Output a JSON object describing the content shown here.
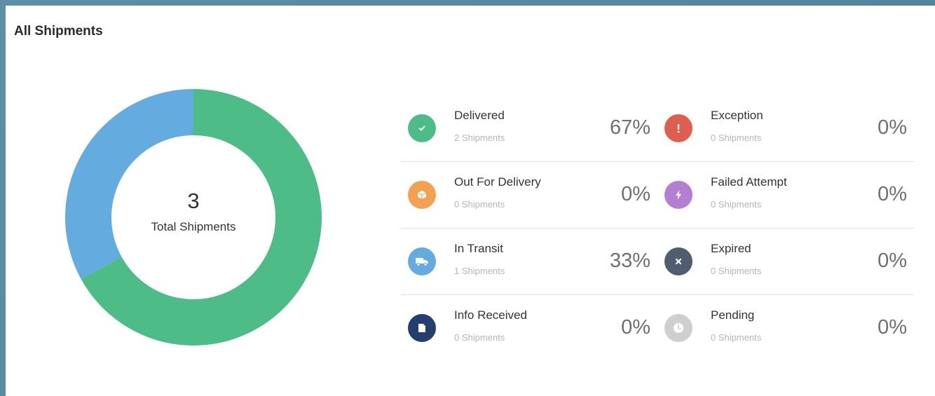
{
  "card": {
    "title": "All Shipments"
  },
  "chart_data": {
    "type": "pie",
    "total": {
      "value": "3",
      "label": "Total Shipments"
    },
    "slices": [
      {
        "label": "Delivered",
        "value": 67,
        "color": "#4dbc86"
      },
      {
        "label": "In Transit",
        "value": 33,
        "color": "#64abe0"
      }
    ]
  },
  "statuses": [
    {
      "name": "Delivered",
      "count": "2 Shipments",
      "pct": "67%",
      "color": "#4dbc86",
      "icon": "check-icon"
    },
    {
      "name": "Exception",
      "count": "0 Shipments",
      "pct": "0%",
      "color": "#de5f4f",
      "icon": "exclamation-icon"
    },
    {
      "name": "Out For Delivery",
      "count": "0 Shipments",
      "pct": "0%",
      "color": "#f2a153",
      "icon": "package-icon"
    },
    {
      "name": "Failed Attempt",
      "count": "0 Shipments",
      "pct": "0%",
      "color": "#b47fd0",
      "icon": "lightning-icon"
    },
    {
      "name": "In Transit",
      "count": "1 Shipments",
      "pct": "33%",
      "color": "#64abe0",
      "icon": "truck-icon"
    },
    {
      "name": "Expired",
      "count": "0 Shipments",
      "pct": "0%",
      "color": "#4f5d70",
      "icon": "x-icon"
    },
    {
      "name": "Info Received",
      "count": "0 Shipments",
      "pct": "0%",
      "color": "#243f6e",
      "icon": "document-icon"
    },
    {
      "name": "Pending",
      "count": "0 Shipments",
      "pct": "0%",
      "color": "#cfcfcf",
      "icon": "clock-icon"
    }
  ]
}
